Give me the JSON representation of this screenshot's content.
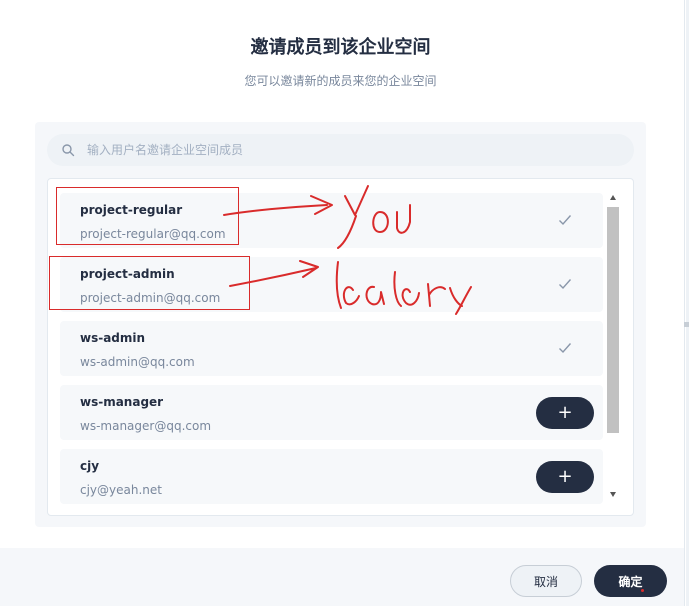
{
  "dialog": {
    "title": "邀请成员到该企业空间",
    "subtitle": "您可以邀请新的成员来您的企业空间"
  },
  "search": {
    "placeholder": "输入用户名邀请企业空间成员",
    "value": "",
    "icon": "search-icon"
  },
  "members": [
    {
      "name": "project-regular",
      "email": "project-regular@qq.com",
      "status": "invited",
      "icon": "check-icon"
    },
    {
      "name": "project-admin",
      "email": "project-admin@qq.com",
      "status": "invited",
      "icon": "check-icon"
    },
    {
      "name": "ws-admin",
      "email": "ws-admin@qq.com",
      "status": "invited",
      "icon": "check-icon"
    },
    {
      "name": "ws-manager",
      "email": "ws-manager@qq.com",
      "status": "not-invited",
      "add_label": "+"
    },
    {
      "name": "cjy",
      "email": "cjy@yeah.net",
      "status": "not-invited",
      "add_label": "+"
    }
  ],
  "annotations": {
    "color": "#d92b2b",
    "notes": [
      "You",
      "leader"
    ]
  },
  "footer": {
    "cancel_label": "取消",
    "confirm_label": "确定"
  },
  "colors": {
    "primary_dark": "#242e42",
    "muted_text": "#79879c",
    "panel_bg": "#f5f7fa",
    "annotation_red": "#d92b2b"
  }
}
